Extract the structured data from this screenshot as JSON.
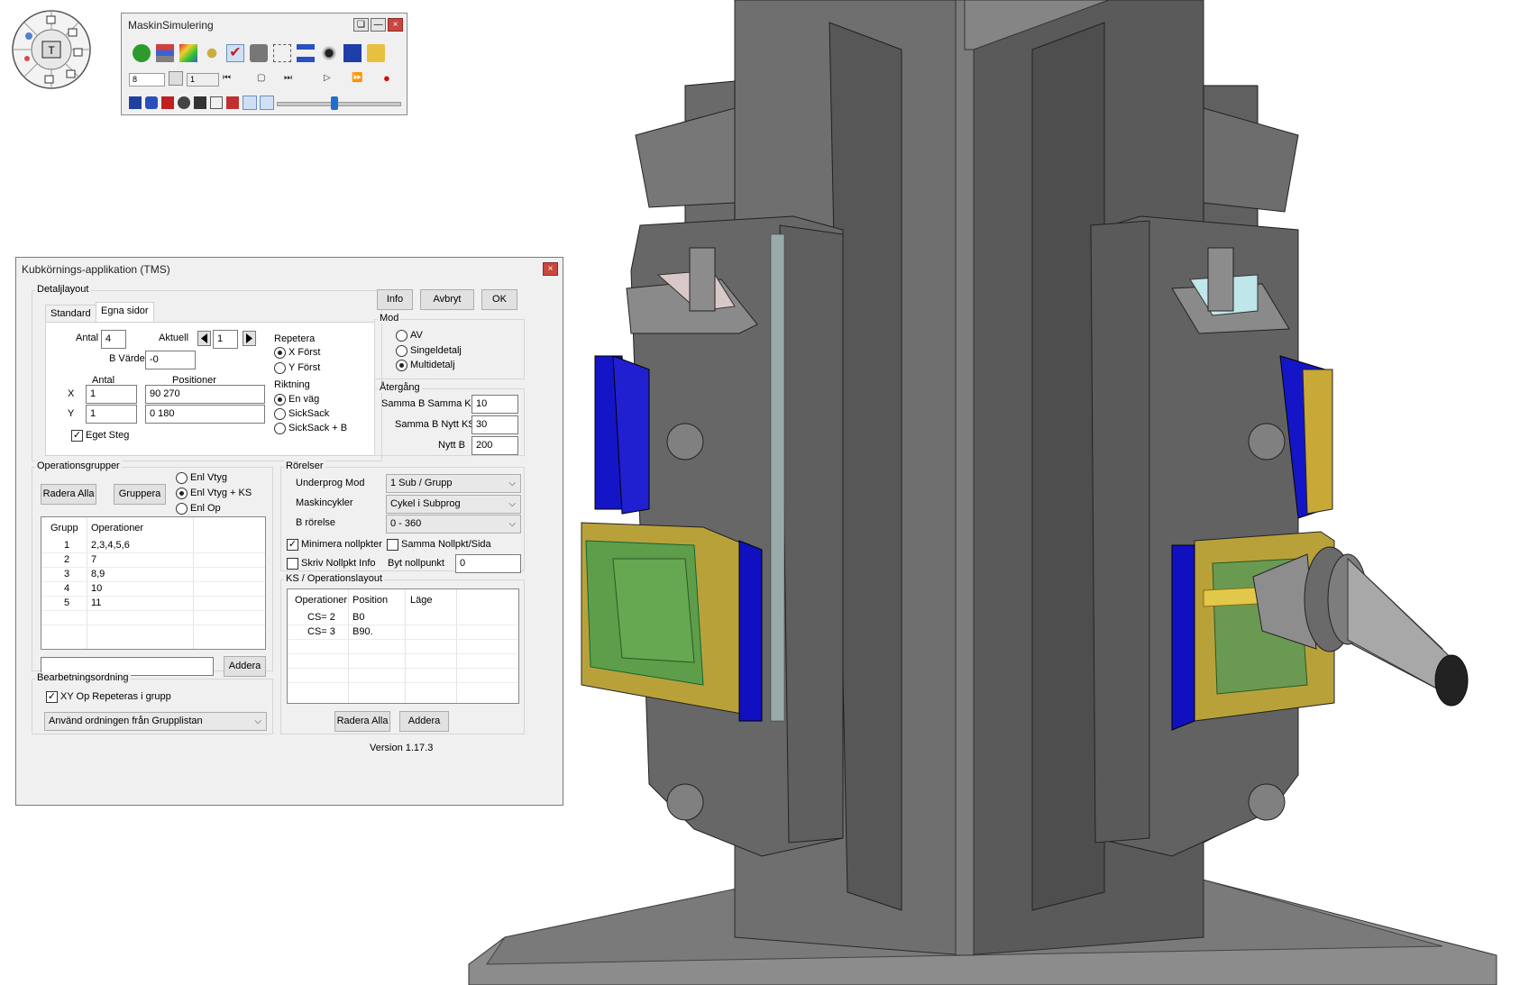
{
  "sim_toolbar": {
    "title": "MaskinSimulering",
    "step_value": "8",
    "count_value": "1",
    "icons": [
      "green-hand-icon",
      "stack-icon",
      "rainbow-icon",
      "spider-icon",
      "check-icon",
      "lock-icon",
      "grid-icon",
      "tree-icon",
      "eye-icon",
      "cube-icon",
      "folder-icon"
    ],
    "playback": [
      "skip-back-icon",
      "frame-icon",
      "skip-forward-icon",
      "play-icon",
      "fast-forward-icon",
      "record-icon"
    ],
    "slider_position": 0.5
  },
  "tms": {
    "title": "Kubkörnings-applikation (TMS)",
    "detaljlayout": {
      "label": "Detaljlayout",
      "tabs": [
        "Standard",
        "Egna sidor"
      ],
      "antal_label": "Antal",
      "antal_value": "4",
      "aktuell_label": "Aktuell",
      "aktuell_value": "1",
      "b_varde_label": "B Värde",
      "b_varde_value": "-0",
      "col_antal": "Antal",
      "col_positioner": "Positioner",
      "x_label": "X",
      "y_label": "Y",
      "x_antal": "1",
      "y_antal": "1",
      "x_pos": "90 270",
      "y_pos": "0 180",
      "eget_steg": "Eget Steg",
      "repetera_label": "Repetera",
      "repetera_options": [
        "X Först",
        "Y Först"
      ],
      "riktning_label": "Riktning",
      "riktning_options": [
        "En väg",
        "SickSack",
        "SickSack + B"
      ]
    },
    "buttons": {
      "info": "Info",
      "avbryt": "Avbryt",
      "ok": "OK"
    },
    "mod": {
      "label": "Mod",
      "options": [
        "AV",
        "Singeldetalj",
        "Multidetalj"
      ]
    },
    "atergang": {
      "label": "Återgång",
      "rows": [
        {
          "label": "Samma B Samma KS",
          "value": "10"
        },
        {
          "label": "Samma B Nytt KS",
          "value": "30"
        },
        {
          "label": "Nytt B",
          "value": "200"
        }
      ]
    },
    "operationsgrupper": {
      "label": "Operationsgrupper",
      "radera_alla": "Radera Alla",
      "gruppera": "Gruppera",
      "radio_options": [
        "Enl Vtyg",
        "Enl Vtyg + KS",
        "Enl Op"
      ],
      "col_grupp": "Grupp",
      "col_operationer": "Operationer",
      "rows": [
        {
          "grupp": "1",
          "ops": "2,3,4,5,6"
        },
        {
          "grupp": "2",
          "ops": "7"
        },
        {
          "grupp": "3",
          "ops": "8,9"
        },
        {
          "grupp": "4",
          "ops": "10"
        },
        {
          "grupp": "5",
          "ops": "11"
        }
      ],
      "addera": "Addera"
    },
    "rorelser": {
      "label": "Rörelser",
      "rows": [
        {
          "label": "Underprog Mod",
          "value": "1 Sub / Grupp"
        },
        {
          "label": "Maskincykler",
          "value": "Cykel i Subprog"
        },
        {
          "label": "B rörelse",
          "value": "0 - 360"
        }
      ],
      "minimera": "Minimera nollpkter",
      "samma": "Samma Nollpkt/Sida",
      "skriv": "Skriv Nollpkt Info",
      "byt_label": "Byt nollpunkt",
      "byt_value": "0"
    },
    "ks": {
      "label": "KS / Operationslayout",
      "col_op": "Operationer",
      "col_pos": "Position",
      "col_lage": "Läge",
      "rows": [
        {
          "op": "CS= 2",
          "pos": "B0"
        },
        {
          "op": "CS= 3",
          "pos": "B90."
        }
      ],
      "radera_alla": "Radera Alla",
      "addera": "Addera"
    },
    "bearbetning": {
      "label": "Bearbetningsordning",
      "xy_check": "XY Op Repeteras i grupp",
      "select": "Använd ordningen från Grupplistan"
    },
    "version": "Version 1.17.3"
  },
  "colors": {
    "steel": "#6b6b6b",
    "steel_dark": "#4a4a4a",
    "blue_plate": "#1010d0",
    "gold": "#c8a836",
    "green_part": "#5c9a48",
    "teal_edge": "#8ad0d8"
  }
}
